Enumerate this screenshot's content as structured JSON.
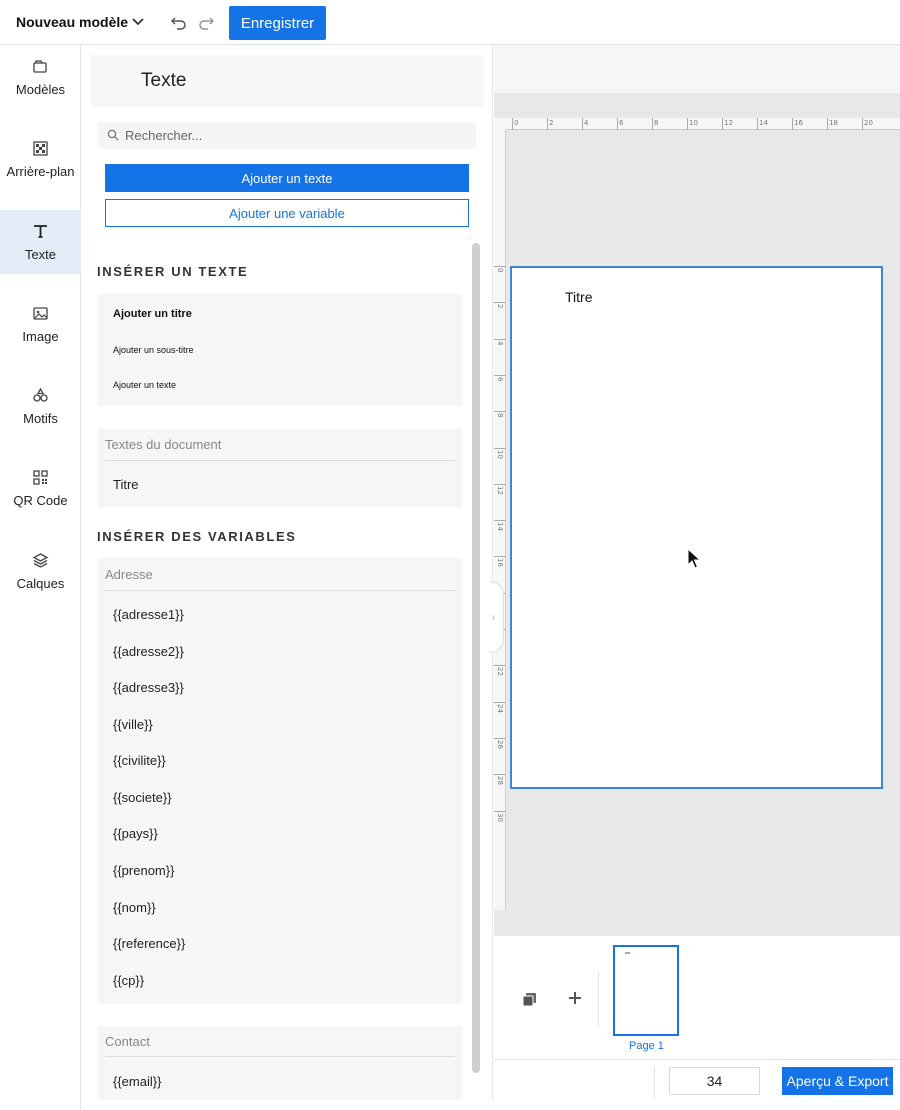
{
  "topbar": {
    "model_name": "Nouveau modèle",
    "save_label": "Enregistrer"
  },
  "nav": [
    {
      "label": "Modèles",
      "icon": "folders-icon",
      "active": false
    },
    {
      "label": "Arrière-plan",
      "icon": "background-icon",
      "active": false
    },
    {
      "label": "Texte",
      "icon": "text-icon",
      "active": true
    },
    {
      "label": "Image",
      "icon": "image-icon",
      "active": false
    },
    {
      "label": "Motifs",
      "icon": "shapes-icon",
      "active": false
    },
    {
      "label": "QR Code",
      "icon": "qr-code-icon",
      "active": false
    },
    {
      "label": "Calques",
      "icon": "layers-icon",
      "active": false
    }
  ],
  "panel": {
    "title": "Texte",
    "search_placeholder": "Rechercher...",
    "add_text_label": "Ajouter un texte",
    "add_variable_label": "Ajouter une variable",
    "insert_text_title": "INSÉRER UN TEXTE",
    "insert_items": [
      "Ajouter un titre",
      "Ajouter un sous-titre",
      "Ajouter un texte"
    ],
    "document_texts": {
      "header": "Textes du document",
      "items": [
        "Titre"
      ]
    },
    "insert_variables_title": "INSÉRER DES VARIABLES",
    "address_group": {
      "header": "Adresse",
      "items": [
        "{{adresse1}}",
        "{{adresse2}}",
        "{{adresse3}}",
        "{{ville}}",
        "{{civilite}}",
        "{{societe}}",
        "{{pays}}",
        "{{prenom}}",
        "{{nom}}",
        "{{reference}}",
        "{{cp}}"
      ]
    },
    "contact_group": {
      "header": "Contact",
      "items": [
        "{{email}}"
      ]
    }
  },
  "canvas": {
    "ruler_top_labels": [
      "0",
      "2",
      "4",
      "6",
      "8",
      "10",
      "12",
      "14",
      "16",
      "18",
      "20"
    ],
    "ruler_left_labels": [
      "0",
      "2",
      "4",
      "6",
      "8",
      "10",
      "12",
      "14",
      "16",
      "18",
      "20",
      "22",
      "24",
      "26",
      "28",
      "30"
    ],
    "page_text": "Titre"
  },
  "pages": {
    "thumbnail_label": "Page 1"
  },
  "footer": {
    "zoom_value": "34",
    "export_label": "Aperçu & Export"
  },
  "colors": {
    "accent": "#1473e6",
    "page_border": "#3c86d6",
    "nav_active_bg": "#e3edf8"
  }
}
